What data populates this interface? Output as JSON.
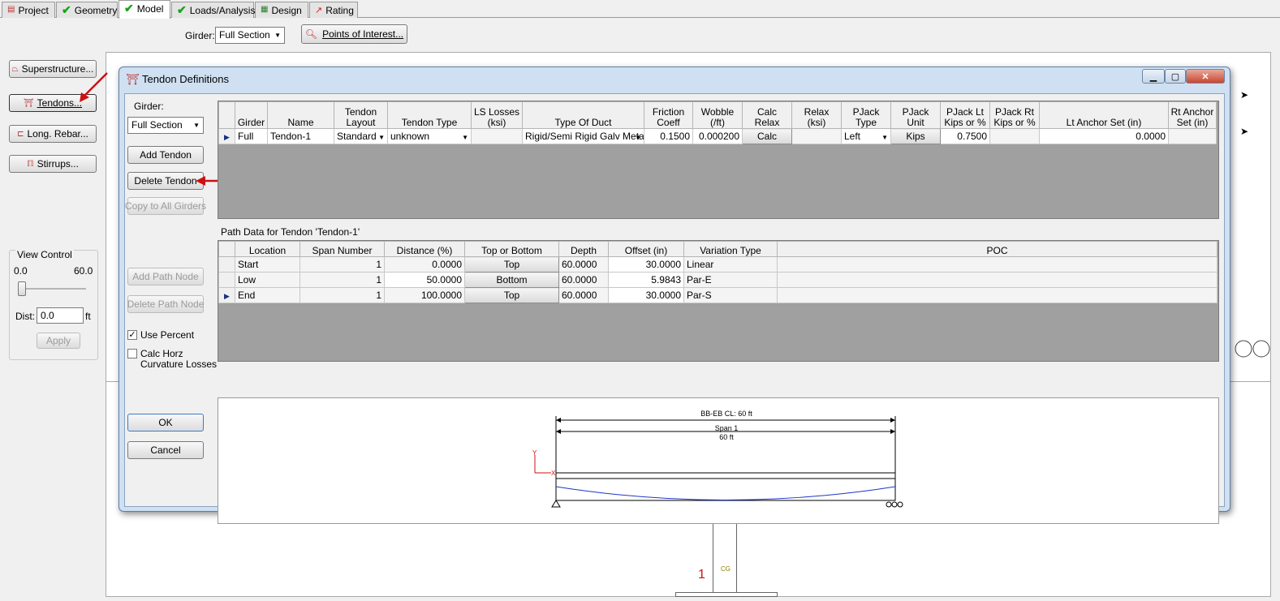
{
  "tabs": [
    {
      "label": "Project",
      "status": "none"
    },
    {
      "label": "Geometry",
      "status": "check"
    },
    {
      "label": "Model",
      "status": "check"
    },
    {
      "label": "Loads/Analysis",
      "status": "check"
    },
    {
      "label": "Design",
      "status": "none"
    },
    {
      "label": "Rating",
      "status": "none"
    }
  ],
  "toolbar": {
    "girder_label": "Girder:",
    "girder_value": "Full Section",
    "poi_button": "Points of Interest..."
  },
  "left_panel": {
    "buttons": [
      "Superstructure...",
      "Tendons...",
      "Long. Rebar...",
      "Stirrups..."
    ]
  },
  "background_labels": {
    "span_label": "1",
    "cg_label": "CG",
    "bg_title": "BB-EB CL: 60 ft"
  },
  "dialog": {
    "title": "Tendon Definitions",
    "girder_label": "Girder:",
    "girder_value": "Full Section",
    "add_tendon": "Add Tendon",
    "delete_tendon": "Delete Tendon",
    "copy_all": "Copy to All Girders",
    "view_control": "View Control",
    "view_min": "0.0",
    "view_max": "60.0",
    "dist_label": "Dist:",
    "dist_value": "0.0",
    "dist_unit": "ft",
    "apply": "Apply",
    "add_path_node": "Add Path Node",
    "delete_path_node": "Delete Path Node",
    "use_percent": "Use Percent",
    "calc_horz_1": "Calc Horz",
    "calc_horz_2": "Curvature Losses",
    "ok": "OK",
    "cancel": "Cancel",
    "tendon_table": {
      "headers": [
        "Girder",
        "Name",
        "Tendon Layout",
        "Tendon Type",
        "LS Losses (ksi)",
        "Type Of Duct",
        "Friction Coeff",
        "Wobble (/ft)",
        "Calc Relax",
        "Relax (ksi)",
        "PJack Type",
        "PJack Unit",
        "PJack Lt Kips or %",
        "PJack Rt Kips or %",
        "Lt Anchor Set (in)",
        "Rt Anchor Set (in)"
      ],
      "row": {
        "girder": "Full",
        "name": "Tendon-1",
        "layout": "Standard",
        "type": "unknown",
        "ls_losses": "",
        "duct": "Rigid/Semi Rigid Galv Meta",
        "friction": "0.1500",
        "wobble": "0.000200",
        "calc_relax": "Calc",
        "relax": "",
        "pjack_type": "Left",
        "pjack_unit": "Kips",
        "pjack_lt": "0.7500",
        "pjack_rt": "",
        "lt_anchor": "0.0000",
        "rt_anchor": ""
      }
    },
    "path_title": "Path Data for Tendon 'Tendon-1'",
    "path_table": {
      "headers": [
        "Location",
        "Span Number",
        "Distance (%)",
        "Top or Bottom",
        "Depth",
        "Offset (in)",
        "Variation Type",
        "POC"
      ],
      "rows": [
        {
          "location": "Start",
          "span": "1",
          "distance": "0.0000",
          "tb": "Top",
          "depth": "60.0000",
          "offset": "30.0000",
          "variation": "Linear",
          "poc": ""
        },
        {
          "location": "Low",
          "span": "1",
          "distance": "50.0000",
          "tb": "Bottom",
          "depth": "60.0000",
          "offset": "5.9843",
          "variation": "Par-E",
          "poc": ""
        },
        {
          "location": "End",
          "span": "1",
          "distance": "100.0000",
          "tb": "Top",
          "depth": "60.0000",
          "offset": "30.0000",
          "variation": "Par-S",
          "poc": ""
        }
      ]
    },
    "preview": {
      "title": "BB-EB CL: 60 ft",
      "span_label": "Span 1",
      "span_len": "60 ft",
      "axis_y": "Y",
      "axis_x": "X"
    }
  },
  "colors": {
    "accent": "#cc1111",
    "check": "#17a317",
    "tendon": "#1f35c8"
  }
}
